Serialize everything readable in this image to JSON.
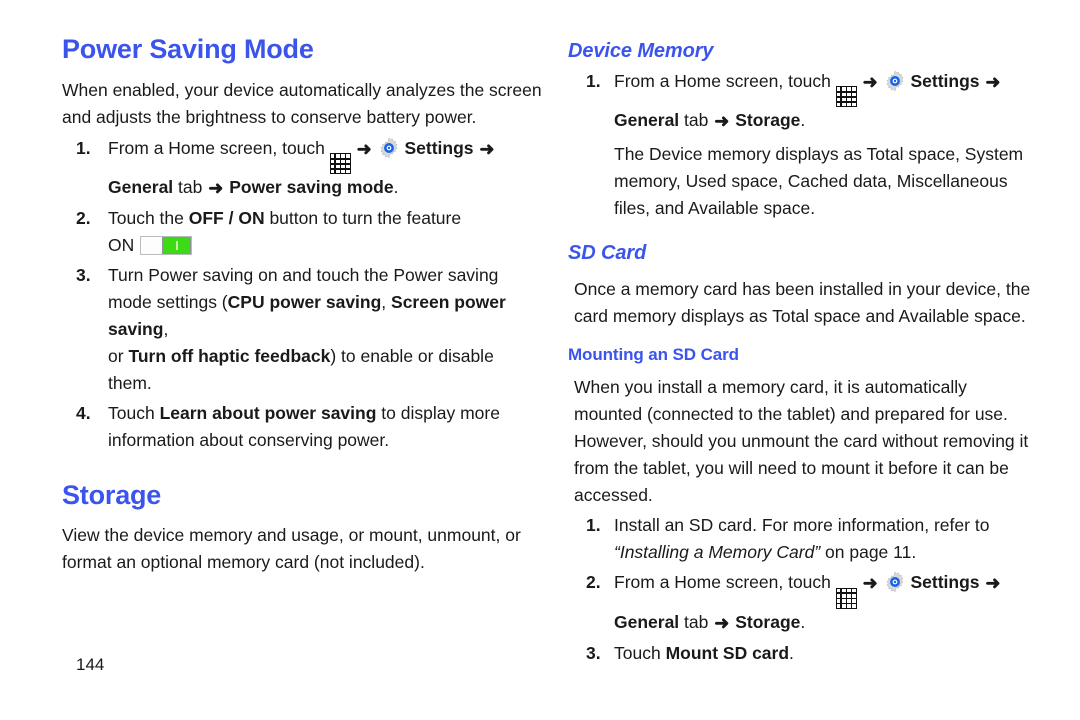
{
  "meta": {
    "page_number": "144",
    "accent_color": "#3b54ec",
    "toggle_on_color": "#3ddb15",
    "body_color": "#1a1a1a"
  },
  "icons": {
    "apps_grid": "apps-grid-icon",
    "settings_gear": "settings-gear-icon",
    "arrow": "➜"
  },
  "left_column": {
    "heading": "Power Saving Mode",
    "intro": "When enabled, your device automatically analyzes the screen and adjusts the brightness to conserve battery power.",
    "steps": [
      {
        "num": "1.",
        "line1_before_icon": "From a Home screen, touch",
        "settings_label": "Settings",
        "line2_a": "General",
        "line2_tab": " tab ",
        "line2_b": "Power saving mode",
        "line2_end": "."
      },
      {
        "num": "2.",
        "text_a": "Touch the ",
        "text_b": "OFF / ON",
        "text_c": " button to turn the feature",
        "on_label": "ON"
      },
      {
        "num": "3.",
        "line1": "Turn Power saving on and touch the Power saving",
        "line2_a": "mode settings (",
        "line2_b": "CPU power saving",
        "line2_c": ", ",
        "line2_d": "Screen power saving",
        "line2_e": ",",
        "line3_a": "or ",
        "line3_b": "Turn off haptic feedback",
        "line3_c": ") to enable or disable them."
      },
      {
        "num": "4.",
        "line1_a": "Touch ",
        "line1_b": "Learn about power saving",
        "line1_c": " to display more",
        "line2": "information about conserving power."
      }
    ],
    "storage_heading": "Storage",
    "storage_body": "View the device memory and usage, or mount, unmount, or format an optional memory card (not included)."
  },
  "right_column": {
    "device_memory_heading": "Device Memory",
    "device_memory_step": {
      "num": "1.",
      "line1_before_icon": "From a Home screen, touch",
      "settings_label": "Settings",
      "line2_a": "General",
      "line2_tab": " tab ",
      "line2_b": "Storage",
      "line2_end": ".",
      "note": "The Device memory displays as Total space, System memory, Used space, Cached data, Miscellaneous files, and Available space."
    },
    "sd_card_heading": "SD Card",
    "sd_card_body": "Once a memory card has been installed in your device, the card memory displays as Total space and Available space.",
    "mounting_heading": "Mounting an SD Card",
    "mounting_body": "When you install a memory card, it is automatically mounted (connected to the tablet) and prepared for use. However, should you unmount the card without removing it from the tablet, you will need to mount it before it can be accessed.",
    "mounting_steps": [
      {
        "num": "1.",
        "line1": "Install an SD card. For more information, refer to",
        "line2_ref": "“Installing a Memory Card”",
        "line2_rest": " on page 11."
      },
      {
        "num": "2.",
        "line1_before_icon": "From a Home screen, touch",
        "settings_label": "Settings",
        "line2_a": "General",
        "line2_tab": " tab ",
        "line2_b": "Storage",
        "line2_end": "."
      },
      {
        "num": "3.",
        "line1_a": "Touch ",
        "line1_b": "Mount SD card",
        "line1_c": "."
      }
    ]
  }
}
